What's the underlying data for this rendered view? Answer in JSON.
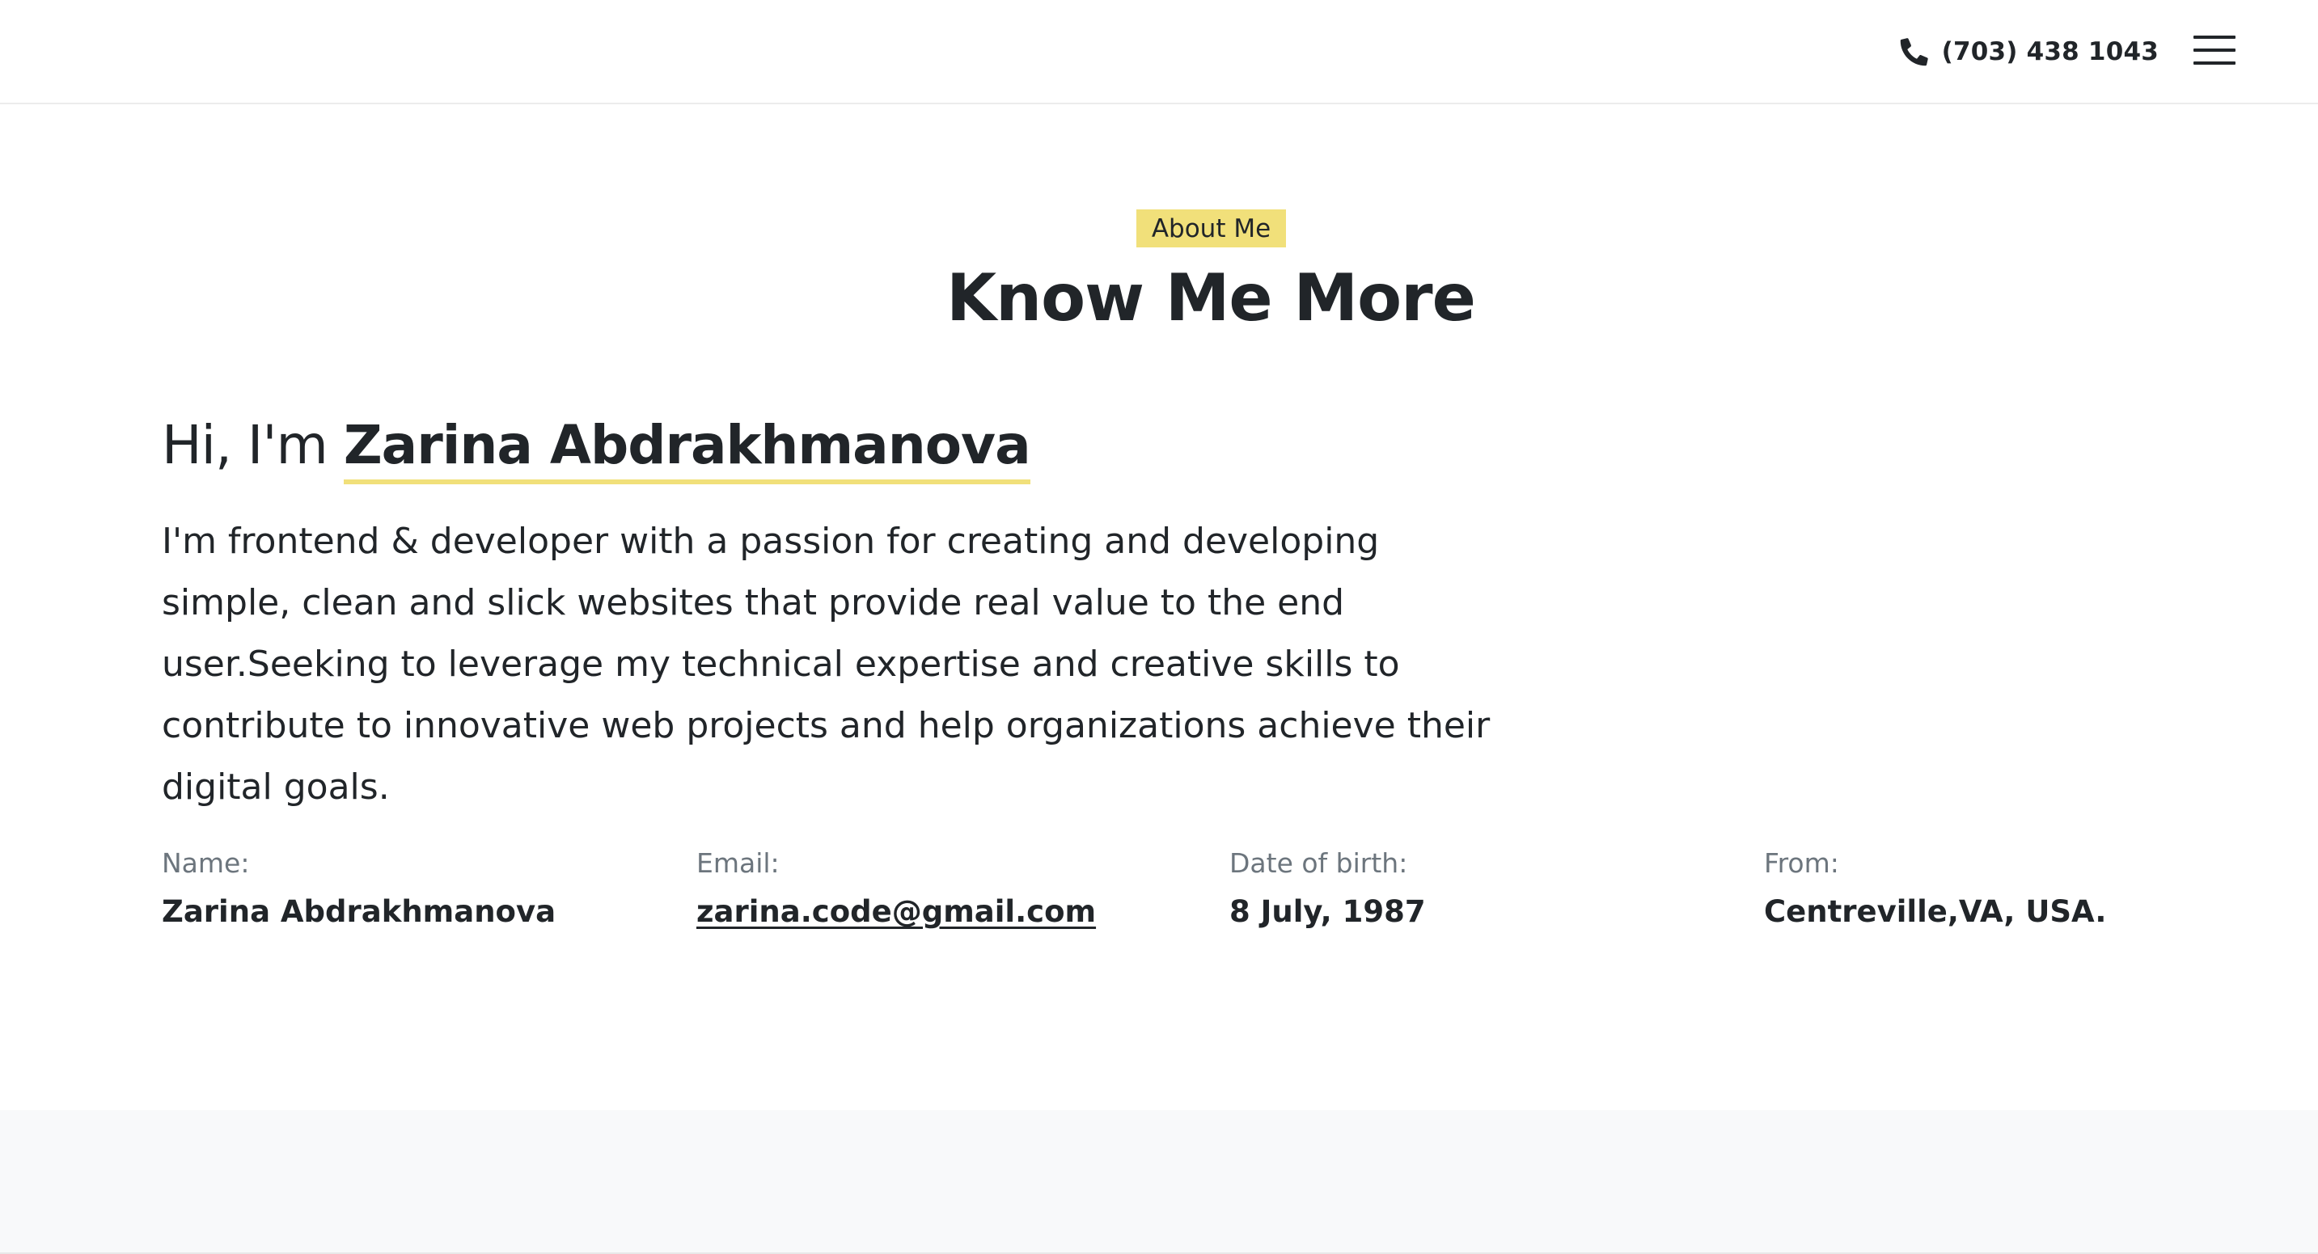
{
  "header": {
    "phone_icon": "phone-icon",
    "phone": "(703) 438 1043",
    "menu_icon": "hamburger-menu-icon"
  },
  "about": {
    "badge": "About Me",
    "title": "Know Me More",
    "greeting": "Hi, I'm",
    "name": "Zarina Abdrakhmanova",
    "description": "I'm frontend & developer with a passion for creating and developing simple, clean and slick websites that provide real value to the end user.Seeking to leverage my technical expertise and creative skills to contribute to innovative web projects and help organizations achieve their digital goals."
  },
  "info": [
    {
      "label": "Name:",
      "value": "Zarina Abdrakhmanova"
    },
    {
      "label": "Email:",
      "value": "zarina.code@gmail.com"
    },
    {
      "label": "Date of birth:",
      "value": "8 July, 1987"
    },
    {
      "label": "From:",
      "value": "Centreville,VA, USA."
    }
  ],
  "colors": {
    "accent": "#f1e07a",
    "text": "#212529",
    "muted": "#6c757d",
    "band": "#f8f9fa"
  }
}
